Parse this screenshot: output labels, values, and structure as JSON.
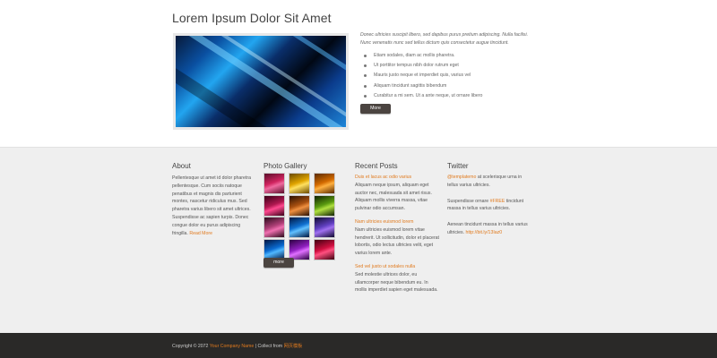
{
  "header": {
    "title": "Lorem Ipsum Dolor Sit Amet"
  },
  "intro": {
    "text": "Donec ultricies suscipit libero, sed dapibus purus pretium adipiscing. Nulla facilisi. Nunc venenatis nunc sed tellus dictum quis consectetur augue tincidunt.",
    "features": [
      "Etiam sodales, diam ac mollis pharetra.",
      "Ut porttitor tempus nibh dolor rutrum eget",
      "Mauris justo neque et imperdiet quis, varius vel",
      "Aliquam tincidunt sagittis bibendum",
      "Curabitur a mi sem. Ut a ante neque, ut ornare libero"
    ],
    "more_label": "More"
  },
  "about": {
    "title": "About",
    "text": "Pellentesque ut amet id dolor pharetra pellentesque. Cum sociis natoque penatibus et magnis dis parturient montes, nascetur ridiculus mus. Sed pharetra varius libero sit amet ultrices. Suspendisse ac sapien turpis. Donec congue dolor eu purus adipiscing fringilla.",
    "read_more": "Read More"
  },
  "gallery": {
    "title": "Photo Gallery",
    "thumbs": [
      {
        "from": "#5b0e2a",
        "mid": "#d0245f",
        "to": "#f06aa0"
      },
      {
        "from": "#6b4a00",
        "mid": "#e0a400",
        "to": "#ffe060"
      },
      {
        "from": "#5a2a00",
        "mid": "#d36a00",
        "to": "#ffb040"
      },
      {
        "from": "#3a0018",
        "mid": "#b01850",
        "to": "#ff4a90"
      },
      {
        "from": "#2a1000",
        "mid": "#a85010",
        "to": "#f09040"
      },
      {
        "from": "#102000",
        "mid": "#5a9a10",
        "to": "#b0e040"
      },
      {
        "from": "#2a0a1a",
        "mid": "#b04078",
        "to": "#f070b0"
      },
      {
        "from": "#001640",
        "mid": "#1070d0",
        "to": "#60c0ff"
      },
      {
        "from": "#100a30",
        "mid": "#6040c0",
        "to": "#a070f0"
      },
      {
        "from": "#001440",
        "mid": "#0a6ad0",
        "to": "#50b8ff"
      },
      {
        "from": "#2a0040",
        "mid": "#9020c0",
        "to": "#e070ff"
      },
      {
        "from": "#400010",
        "mid": "#d01040",
        "to": "#ff5080"
      }
    ],
    "more_label": "more"
  },
  "posts": {
    "title": "Recent Posts",
    "items": [
      {
        "title": "Duis et lacus ac odio varius",
        "text": "Aliquam neque ipsum, aliquam eget auctor nec, malesuada sit amet risus. Aliquam mollis viverra massa, vitae pulvinar odio accumsan."
      },
      {
        "title": "Nam ultricies euismod lorem",
        "text": "Nam ultricies euismod lorem vitae hendrerit. Ut sollicitudin, dolor et placerat lobortis, odio lectus ultricies velit, eget varius lorem ante."
      },
      {
        "title": "Sed vel justo ut sodales nulla",
        "text": "Sed molestie ultrices dolor, eu ullamcorper neque bibendum eu. In mollis imperdiet sapien eget malesuada."
      }
    ]
  },
  "twitter": {
    "title": "Twitter",
    "tweets": [
      {
        "link": "@templatemo",
        "text": " at scelerisque urna in tellus varius ultricies."
      },
      {
        "text": "Suspendisse ornare ",
        "link": "#FREE",
        "after": " tincidunt massa in tellus varius ultricies."
      },
      {
        "text": "Aenean tincidunt massa in tellus varius ultricies. ",
        "link": "http://bit.ly/13Iaz0"
      }
    ]
  },
  "footer": {
    "copyright": "Copyright © 2072",
    "company": "Your Company Name",
    "separator": "| Collect from",
    "source": "网页模板"
  },
  "colors": {
    "accent": "#e07a1e",
    "button": "#4b4440",
    "footer_bg": "#2a2928",
    "mid_bg": "#efefef"
  }
}
